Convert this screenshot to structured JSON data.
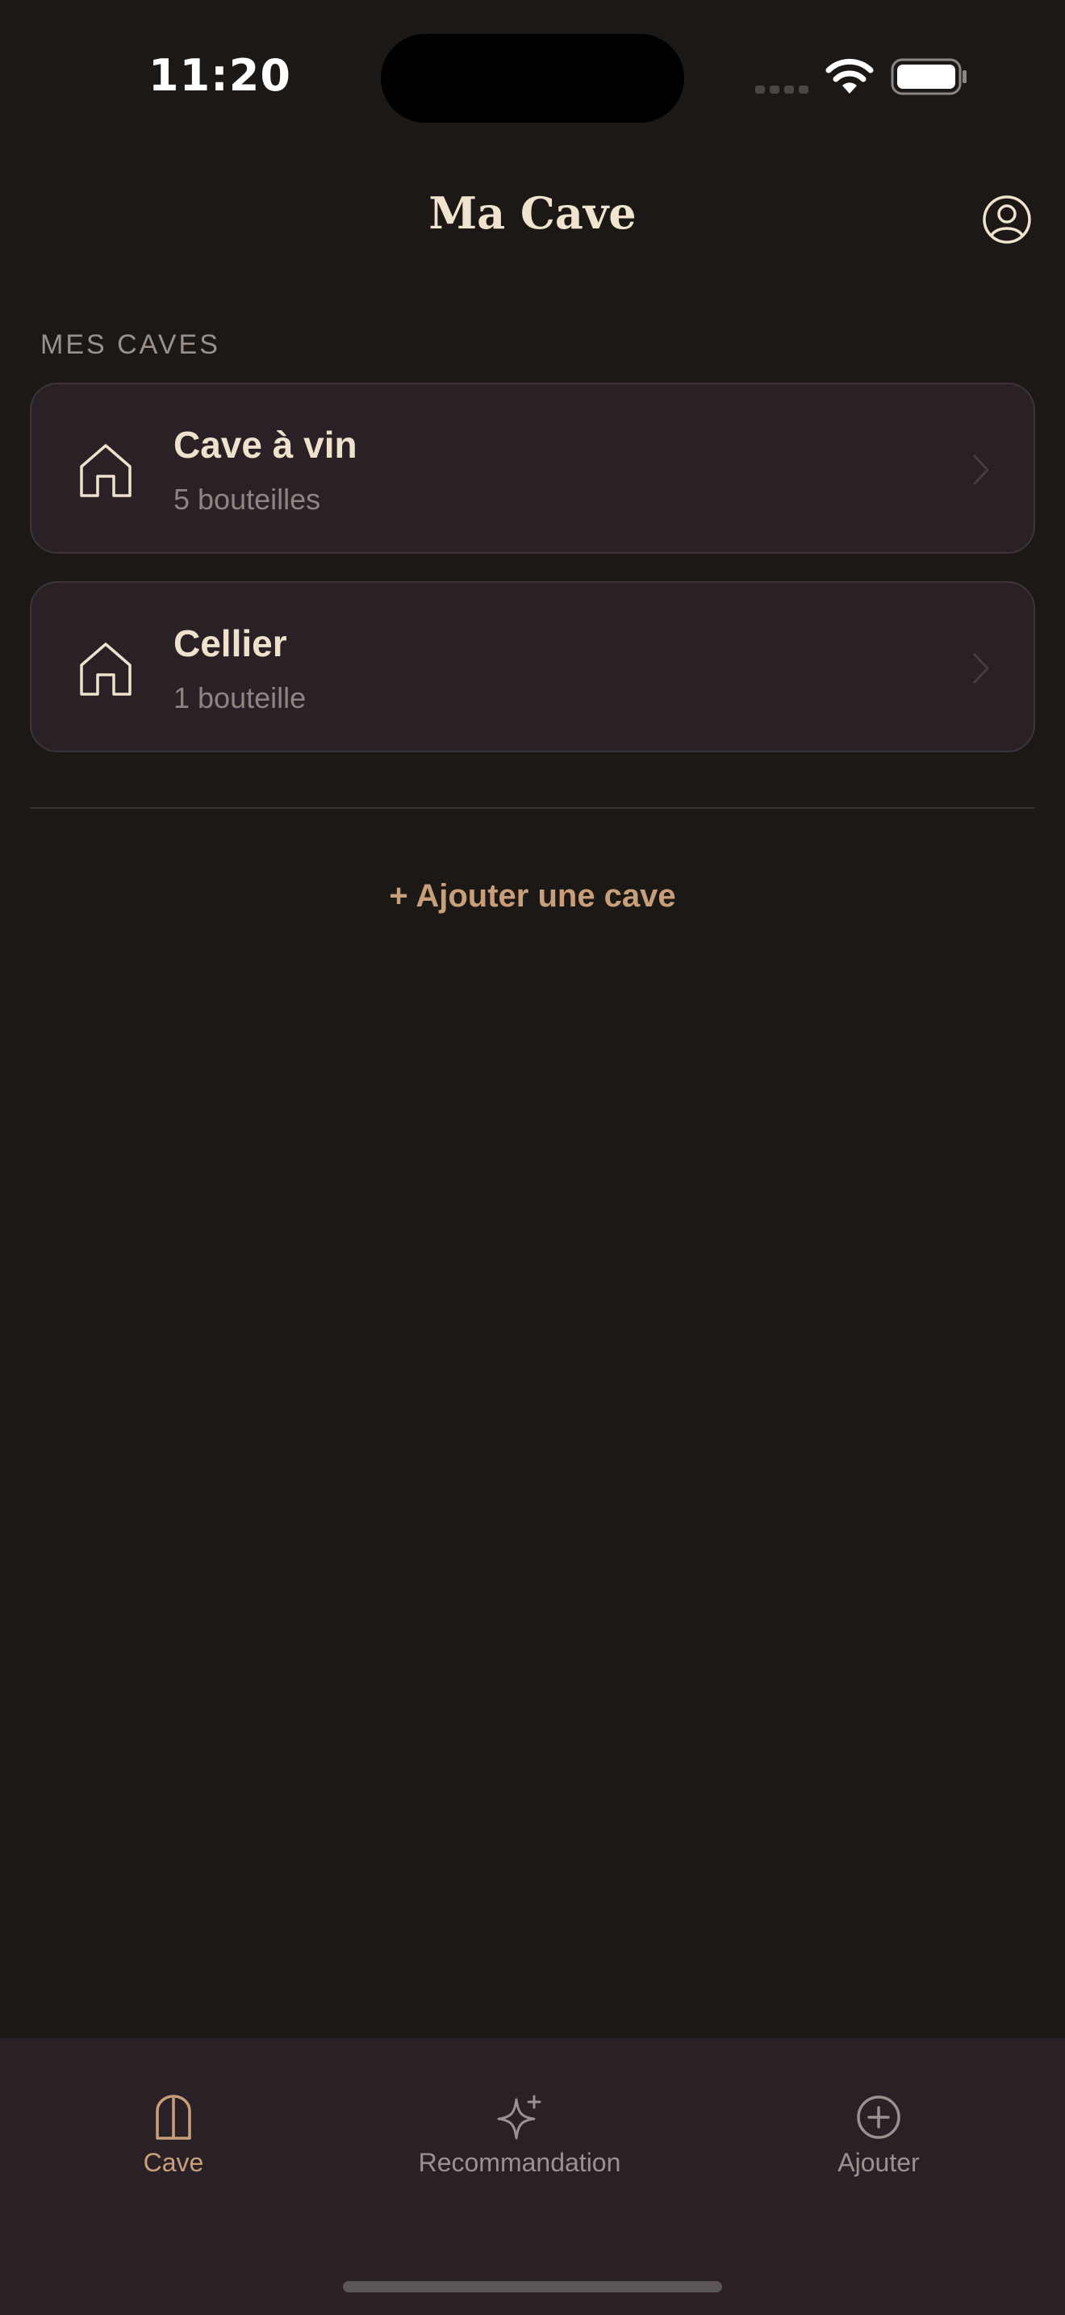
{
  "status_bar": {
    "time": "11:20"
  },
  "header": {
    "title": "Ma Cave",
    "profile_icon": "person-circle-icon"
  },
  "section": {
    "label": "MES CAVES"
  },
  "cellars": [
    {
      "name": "Cave à vin",
      "count": "5 bouteilles",
      "icon": "house-icon"
    },
    {
      "name": "Cellier",
      "count": "1 bouteille",
      "icon": "house-icon"
    }
  ],
  "add_cellar_label": "+ Ajouter une cave",
  "tab_bar": {
    "tabs": [
      {
        "label": "Cave",
        "icon": "cellar-door-icon",
        "active": true
      },
      {
        "label": "Recommandation",
        "icon": "sparkles-icon",
        "active": false
      },
      {
        "label": "Ajouter",
        "icon": "plus-circle-icon",
        "active": false
      }
    ]
  },
  "colors": {
    "background": "#1c1816",
    "card": "#2a2126",
    "accent": "#c99f7a",
    "text_primary": "#eee2cc",
    "text_secondary": "#8e8580"
  }
}
